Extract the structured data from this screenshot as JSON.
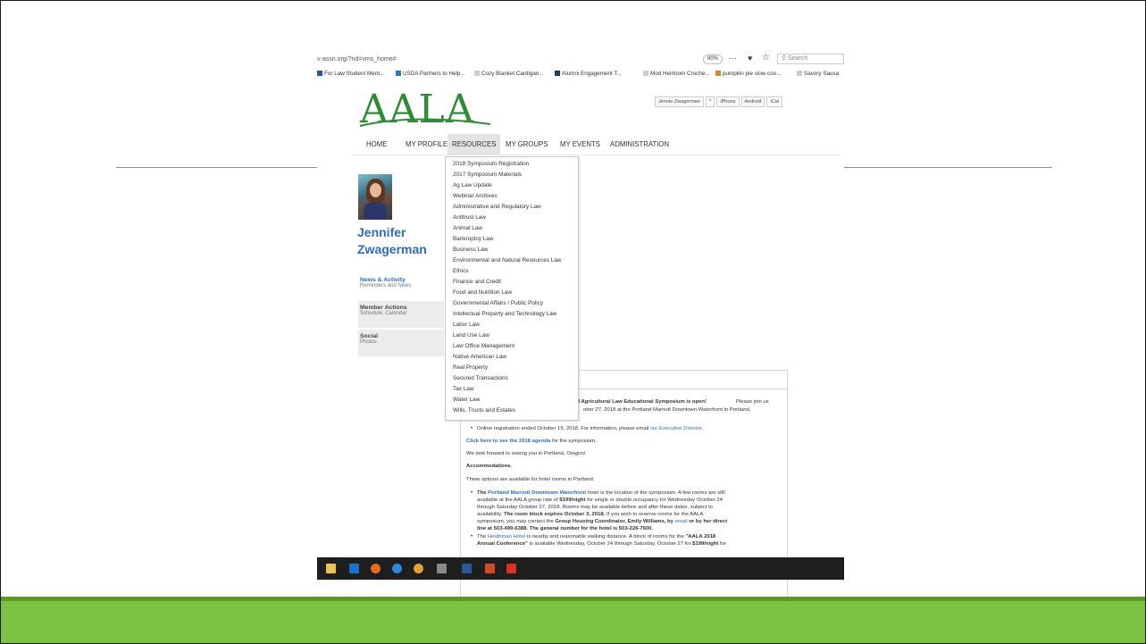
{
  "browser": {
    "url": "v-assn.org/?nd=vms_home#",
    "zoom": "90%",
    "more_icon": "···",
    "pocket_icon": "♥",
    "star_icon": "☆",
    "search_placeholder": "Search"
  },
  "bookmarks": [
    {
      "label": "For Law Student Ment...",
      "color": "#2b5797"
    },
    {
      "label": "USDA Partners to Help...",
      "color": "#2b7bb9"
    },
    {
      "label": "Cozy Blanket Cardigan...",
      "color": "#cccccc"
    },
    {
      "label": "Alumni Engagement T...",
      "color": "#1f3b73"
    },
    {
      "label": "Mod Heirloom Croche...",
      "color": "#cccccc"
    },
    {
      "label": "pumpkin pie slow coo...",
      "color": "#d08a2e"
    },
    {
      "label": "Savory Sausa",
      "color": "#cccccc"
    }
  ],
  "site": {
    "logo": "AALA",
    "user_buttons": [
      "Jennie Zwagerman",
      "^",
      "iPhone",
      "Android",
      "iCal"
    ]
  },
  "nav": [
    "HOME",
    "MY PROFILE",
    "RESOURCES",
    "MY GROUPS",
    "MY EVENTS",
    "ADMINISTRATION"
  ],
  "profile": {
    "first_name": "Jennifer",
    "last_name": "Zwagerman",
    "sections": [
      {
        "title": "News & Activity",
        "sub": "Reminders and News"
      },
      {
        "title": "Member Actions",
        "sub": "Schedule, Calendar"
      },
      {
        "title": "Social",
        "sub": "Photos"
      }
    ]
  },
  "resources_menu": [
    "2018 Symposium Registration",
    "2017 Symposium Materials",
    "Ag Law Update",
    "Webinar Archives",
    "Administrative and Regulatory Law",
    "Antitrust Law",
    "Animal Law",
    "Bankruptcy Law",
    "Business Law",
    "Environmental and Natural Resources Law",
    "Ethics",
    "Finance and Credit",
    "Food and Nutrition Law",
    "Governmental Affairs / Public Policy",
    "Intellectual Property and Technology Law",
    "Labor Law",
    "Land Use Law",
    "Law Office Management",
    "Native American Law",
    "Real Property",
    "Secured Transactions",
    "Tax Law",
    "Water Law",
    "Wills, Trusts and Estates"
  ],
  "content": {
    "intro_a": "nual Agricultural Law Educational Symposium is open!",
    "intro_b": "Please join us",
    "intro_c": "ober 27, 2018 at the Portland Marriott Downtown Waterfront in Portland,",
    "reg_text": "Online registration ended October 15, 2018. For information, please email",
    "reg_link": "our Executive Director.",
    "agenda_link": "Click here to see the 2018 agenda",
    "agenda_rest": "for the symposium.",
    "look_forward": "We look forward to seeing you in Portland, Oregon!",
    "accom_title": "Accommodations.",
    "accom_intro": "Three options are available for hotel rooms in Portland:",
    "h1_the": "The",
    "h1_link": "Portland Marriott Downtown Waterfront",
    "h1_rest": "hotel is the location of the symposium. A few rooms are still",
    "h1_l2a": "available at the AALA group rate of",
    "h1_l2b": "$199/night",
    "h1_l2c": "for single or double occupancy for Wednesday October 24",
    "h1_l3": "through Saturday October 27, 2018. Rooms may be available before and after these dates, subject to",
    "h1_l4a": "availability.",
    "h1_l4b": "The room block expires October 3, 2018.",
    "h1_l4c": "If you wish to reserve rooms for the AALA",
    "h1_l5a": "symposium, you may contact the",
    "h1_l5b": "Group Housing Coordinator, Emily Williams, by",
    "h1_l5c": "email",
    "h1_l5d": "or by her direct",
    "h1_l6": "line at 503-499-6388. The general number for the hotel is 503-226-7600.",
    "h2_the": "The",
    "h2_link": "Heathman Hotel",
    "h2_rest": "is nearby and reasonable walking distance.  A block of rooms for the",
    "h2_quote": "\"AALA 2018",
    "h2_l2a": "Annual Conference\"",
    "h2_l2b": "is available Wednesday, October 24 through Saturday, October 27 for",
    "h2_l2c": "$199/night",
    "h2_l2d": "for"
  },
  "taskbar": [
    "file-explorer-icon",
    "outlook-icon",
    "firefox-icon",
    "edge-icon",
    "chrome-icon",
    "calculator-icon",
    "word-icon",
    "powerpoint-icon",
    "acrobat-icon"
  ],
  "colors": {
    "green_band": "#7cc242",
    "green_band_top": "#5b9a29",
    "logo_green": "#2f8b36",
    "link_blue": "#2e6db3"
  }
}
